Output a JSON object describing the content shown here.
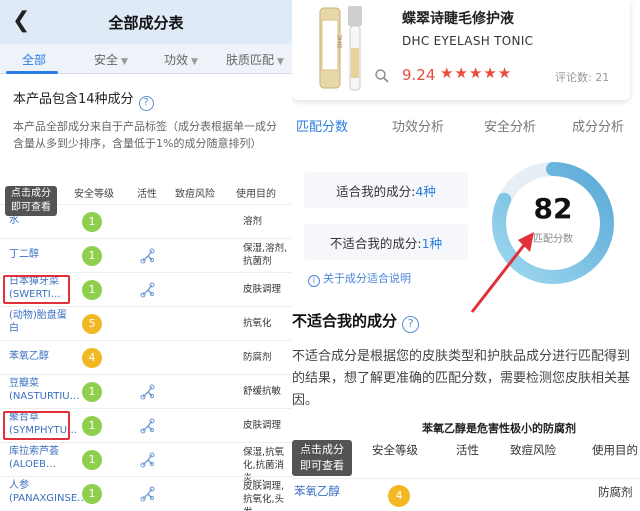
{
  "left": {
    "header": {
      "back_icon": "chevron-left-icon",
      "title": "全部成分表"
    },
    "tabs": [
      {
        "label": "全部",
        "active": true
      },
      {
        "label": "安全",
        "active": false
      },
      {
        "label": "功效",
        "active": false
      },
      {
        "label": "肤质匹配",
        "active": false
      }
    ],
    "count_text": "本产品包含14种成分",
    "description": "本产品全部成分来自于产品标签（成分表根据单一成分含量从多到少排序，含量低于1%的成分随意排列）",
    "tooltip": "点击成分\n即可查看",
    "columns": [
      "成分",
      "安全等级",
      "活性",
      "致痘风险",
      "使用目的"
    ],
    "rows": [
      {
        "name": "水",
        "level": "1",
        "level_color": "green",
        "active": false,
        "use": "溶剂"
      },
      {
        "name": "丁二醇",
        "level": "1",
        "level_color": "green",
        "active": true,
        "use": "保湿,溶剂,抗菌剂"
      },
      {
        "name": "日本獐牙菜(SWERTI…",
        "level": "1",
        "level_color": "green",
        "active": true,
        "use": "皮肤调理"
      },
      {
        "name": "(动物)胎盘蛋白",
        "level": "5",
        "level_color": "yellow",
        "active": false,
        "use": "抗氧化"
      },
      {
        "name": "苯氧乙醇",
        "level": "4",
        "level_color": "yellow",
        "active": false,
        "use": "防腐剂"
      },
      {
        "name": "豆瓣菜(NASTURTIU…",
        "level": "1",
        "level_color": "green",
        "active": true,
        "use": "舒缓抗敏"
      },
      {
        "name": "聚合草(SYMPHYTU…",
        "level": "1",
        "level_color": "green",
        "active": true,
        "use": "皮肤调理"
      },
      {
        "name": "库拉索芦荟(ALOEB…",
        "level": "1",
        "level_color": "green",
        "active": true,
        "use": "保湿,抗氧化,抗菌消炎,…"
      },
      {
        "name": "人参(PANAXGINSE…",
        "level": "1",
        "level_color": "green",
        "active": true,
        "use": "皮肤调理,抗氧化,头发…"
      }
    ]
  },
  "right": {
    "product": {
      "name": "蝶翠诗睫毛修护液",
      "brand": "DHC EYELASH TONIC",
      "rating": "9.24",
      "stars": "★★★★★",
      "review_count": "评论数: 21"
    },
    "tabs": [
      {
        "label": "匹配分数",
        "active": true
      },
      {
        "label": "功效分析",
        "active": false
      },
      {
        "label": "安全分析",
        "active": false
      },
      {
        "label": "成分分析",
        "active": false
      }
    ],
    "suitable_label": "适合我的成分:",
    "suitable_count": "4种",
    "unsuitable_label": "不适合我的成分:",
    "unsuitable_count": "1种",
    "about_link": "关于成分适合说明",
    "score": "82",
    "score_fraction": 0.82,
    "score_label": "匹配分数",
    "section_title": "不适合我的成分",
    "section_desc": "不适合成分是根据您的皮肤类型和护肤品成分进行匹配得到的结果，想了解更准确的匹配分数，需要检测您皮肤相关基因。",
    "subtitle": "苯氧乙醇是危害性极小的防腐剂",
    "tooltip": "点击成分\n即可查看",
    "columns": [
      "成分",
      "安全等级",
      "活性",
      "致痘风险",
      "使用目的"
    ],
    "row": {
      "name": "苯氧乙醇",
      "level": "4",
      "use": "防腐剂"
    }
  }
}
